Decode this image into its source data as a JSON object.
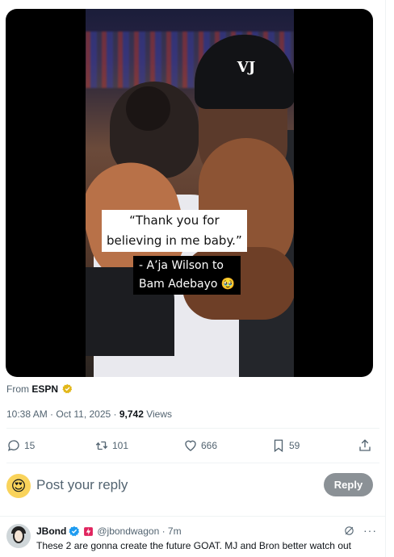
{
  "video": {
    "quote_line1": "“Thank you for",
    "quote_line2": "believing in me baby.”",
    "attribution_line1": "- A’ja Wilson to",
    "attribution_line2": "Bam Adebayo",
    "attribution_emoji": "🥹",
    "cap_logo": "VJ"
  },
  "source": {
    "prefix": "From",
    "name": "ESPN"
  },
  "meta": {
    "timestamp": "10:38 AM · Oct 11, 2025 · ",
    "views_count": "9,742",
    "views_label": " Views"
  },
  "actions": {
    "replies": "15",
    "reposts": "101",
    "likes": "666",
    "bookmarks": "59"
  },
  "reply": {
    "placeholder": "Post your reply",
    "avatar_emoji": "😍",
    "button_label": "Reply"
  },
  "comment": {
    "name": "JBond",
    "handle": "@jbondwagon · 7m",
    "text": "These 2 are gonna create the future GOAT. MJ and Bron better watch out",
    "more_label": "···"
  },
  "colors": {
    "verified_blue": "#1d9bf0",
    "verified_gold": "#e2b719",
    "muted": "#536471",
    "badge_red": "#e0245e"
  }
}
